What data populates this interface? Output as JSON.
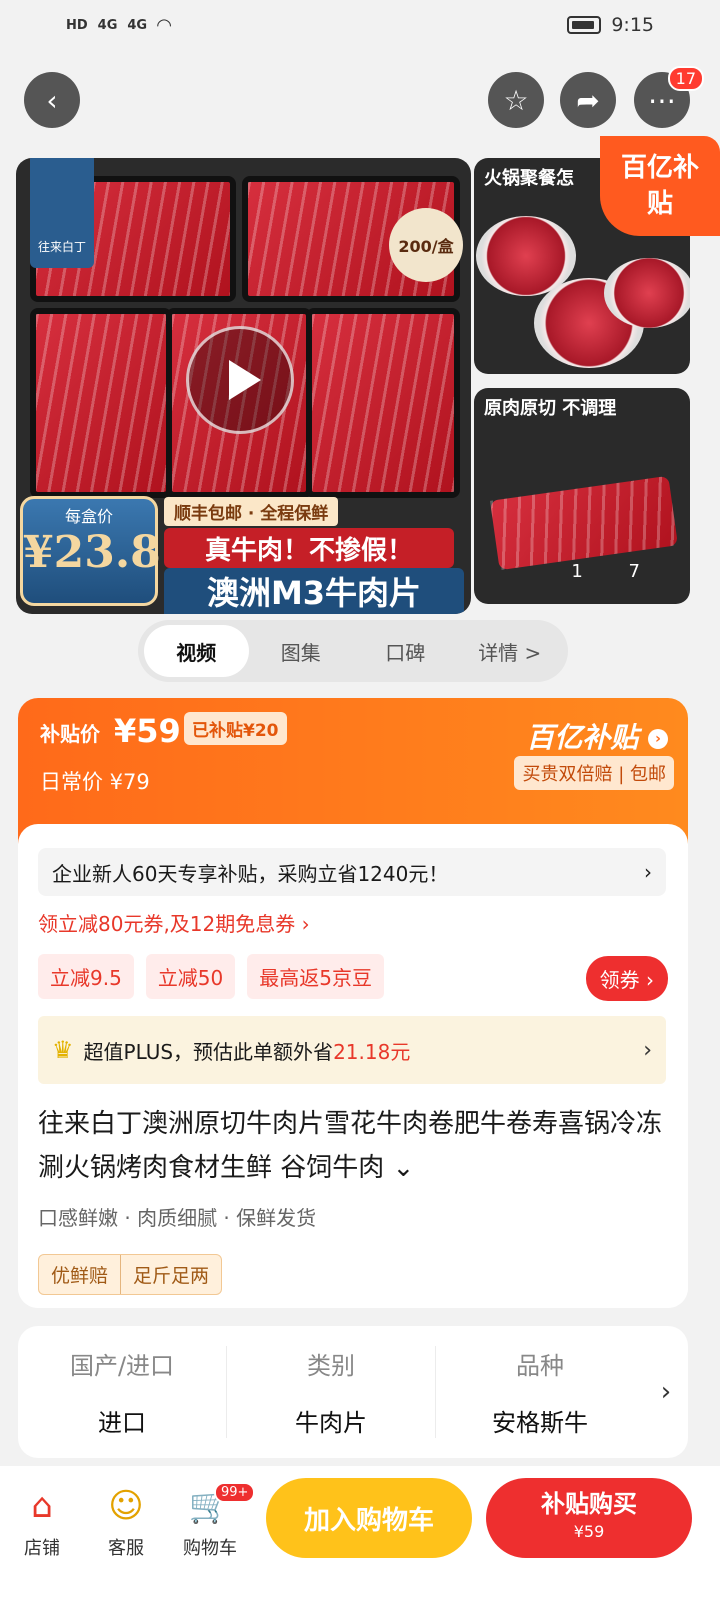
{
  "status": {
    "left_labels": [
      "HD",
      "4G",
      "4G"
    ],
    "time": "9:15"
  },
  "nav": {
    "more_badge": "17"
  },
  "gallery": {
    "main": {
      "brand": "往来白丁",
      "box_price": "200/盒",
      "per_box_label": "每盒价",
      "per_box_price": "¥23.8",
      "shipping": "顺丰包邮 · 全程保鲜",
      "slogan": "真牛肉！不掺假！",
      "product_name": "澳洲M3牛肉片"
    },
    "side1_title": "火锅聚餐怎",
    "side2_title": "原肉原切 不调理",
    "subsidy_corner": "百亿补贴",
    "counter": "1 7"
  },
  "tabs": [
    "视频",
    "图集",
    "口碑",
    "详情 >"
  ],
  "price": {
    "subsidy_label": "补贴价",
    "subsidy_price": "¥59",
    "subsidized_chip": "已补贴¥20",
    "daily_label": "日常价 ¥79",
    "brand": "百亿补贴",
    "guarantee": "买贵双倍赔 | 包邮"
  },
  "promo": {
    "newcomer": "企业新人60天专享补贴，采购立省1240元！",
    "coupon_link": "领立减80元券,及12期免息券 ›",
    "tags": [
      "立减9.5",
      "立减50",
      "最高返5京豆"
    ],
    "get_coupon": "领券",
    "plus_text_a": "超值PLUS，预估此单额外省",
    "plus_amount": "21.18元"
  },
  "product": {
    "title": "往来白丁澳洲原切牛肉片雪花牛肉卷肥牛卷寿喜锅冷冻涮火锅烤肉食材生鲜 谷饲牛肉 ⌄",
    "features": "口感鲜嫩 · 肉质细腻 · 保鲜发货",
    "badges": [
      "优鲜赔",
      "足斤足两"
    ]
  },
  "specs": [
    {
      "k": "国产/进口",
      "v": "进口"
    },
    {
      "k": "类别",
      "v": "牛肉片"
    },
    {
      "k": "品种",
      "v": "安格斯牛"
    }
  ],
  "bottom": {
    "store": "店铺",
    "service": "客服",
    "cart": "购物车",
    "cart_badge": "99+",
    "add_cart": "加入购物车",
    "buy_now": "补贴购买",
    "buy_price": "¥59"
  }
}
